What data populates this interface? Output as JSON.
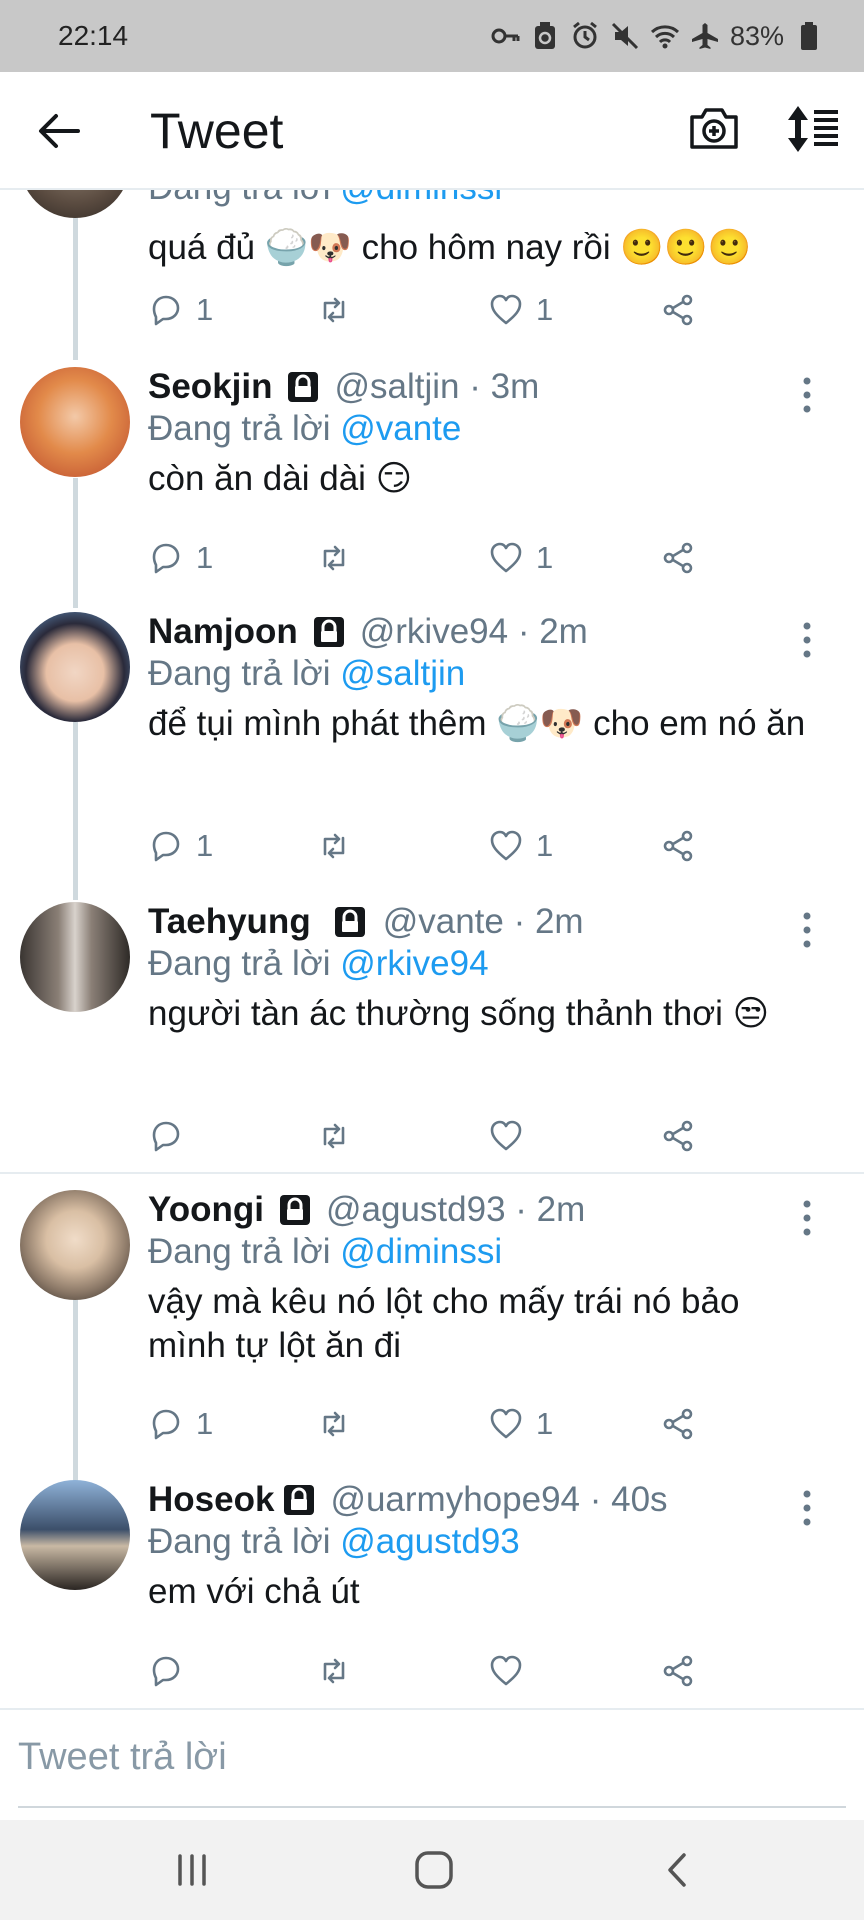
{
  "status_bar": {
    "time": "22:14",
    "battery_pct": "83%"
  },
  "header": {
    "title": "Tweet"
  },
  "tweets": [
    {
      "replying_prefix": "Đang trả lời ",
      "replying_to": "@diminssi",
      "text": "quá đủ 🍚🐶 cho hôm nay rồi 🙂🙂🙂",
      "reply_count": "1",
      "like_count": "1"
    },
    {
      "name": "Seokjin",
      "handle": "@saltjin · 3m",
      "replying_prefix": "Đang trả lời ",
      "replying_to": "@vante",
      "text": "còn ăn dài dài 😏",
      "reply_count": "1",
      "like_count": "1"
    },
    {
      "name": "Namjoon",
      "handle": "@rkive94 · 2m",
      "replying_prefix": "Đang trả lời ",
      "replying_to": "@saltjin",
      "text": "để tụi mình phát thêm 🍚🐶 cho em nó ăn",
      "reply_count": "1",
      "like_count": "1"
    },
    {
      "name": "Taehyung",
      "handle": "@vante · 2m",
      "replying_prefix": "Đang trả lời ",
      "replying_to": "@rkive94",
      "text": "người tàn ác thường sống thảnh thơi 😒",
      "reply_count": "",
      "like_count": ""
    },
    {
      "name": "Yoongi",
      "handle": "@agustd93 · 2m",
      "replying_prefix": "Đang trả lời ",
      "replying_to": "@diminssi",
      "text": "vậy mà kêu nó lột cho mấy trái nó bảo mình tự lột ăn đi",
      "reply_count": "1",
      "like_count": "1"
    },
    {
      "name": "Hoseok",
      "handle": "@uarmyhope94 · 40s",
      "replying_prefix": "Đang trả lời ",
      "replying_to": "@agustd93",
      "text": "em với chả út",
      "reply_count": "",
      "like_count": ""
    }
  ],
  "reply_box": {
    "placeholder": "Tweet trả lời"
  },
  "icons": {
    "back": "arrow-left-icon",
    "camera": "camera-plus-icon",
    "sort": "sort-icon",
    "reply": "speech-bubble-icon",
    "retweet": "retweet-icon",
    "like": "heart-icon",
    "share": "share-icon",
    "lock": "lock-icon",
    "more": "more-vertical-icon"
  },
  "colors": {
    "mention": "#1d9bf0",
    "secondary_text": "#657786",
    "status_bar": "#c8c8c8"
  }
}
